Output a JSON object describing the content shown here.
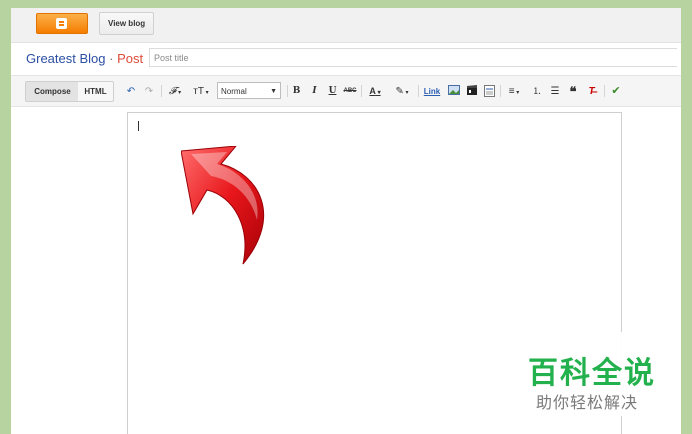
{
  "topbar": {
    "logo_icon": "blogger-logo-icon",
    "view_blog_label": "View blog"
  },
  "header": {
    "blog_name": "Greatest Blog",
    "separator": "·",
    "section": "Post",
    "post_title_placeholder": "Post title"
  },
  "toolbar": {
    "compose_label": "Compose",
    "html_label": "HTML",
    "format_value": "Normal",
    "link_label": "Link",
    "icons": [
      "undo-icon",
      "redo-icon",
      "font-family-icon",
      "font-size-icon",
      "bold-icon",
      "italic-icon",
      "underline-icon",
      "strikethrough-icon",
      "text-color-icon",
      "highlight-color-icon",
      "link-icon",
      "insert-image-icon",
      "insert-video-icon",
      "insert-jump-break-icon",
      "align-icon",
      "numbered-list-icon",
      "bulleted-list-icon",
      "quote-icon",
      "remove-formatting-icon",
      "spell-check-icon"
    ]
  },
  "colors": {
    "page_bg": "#b7d39f",
    "blog_name": "#2c4fa3",
    "post_label": "#dd4b39",
    "arrow": "#e8171b",
    "watermark_green": "#22b14c"
  },
  "watermark": {
    "title": "百科全说",
    "subtitle": "助你轻松解决"
  }
}
